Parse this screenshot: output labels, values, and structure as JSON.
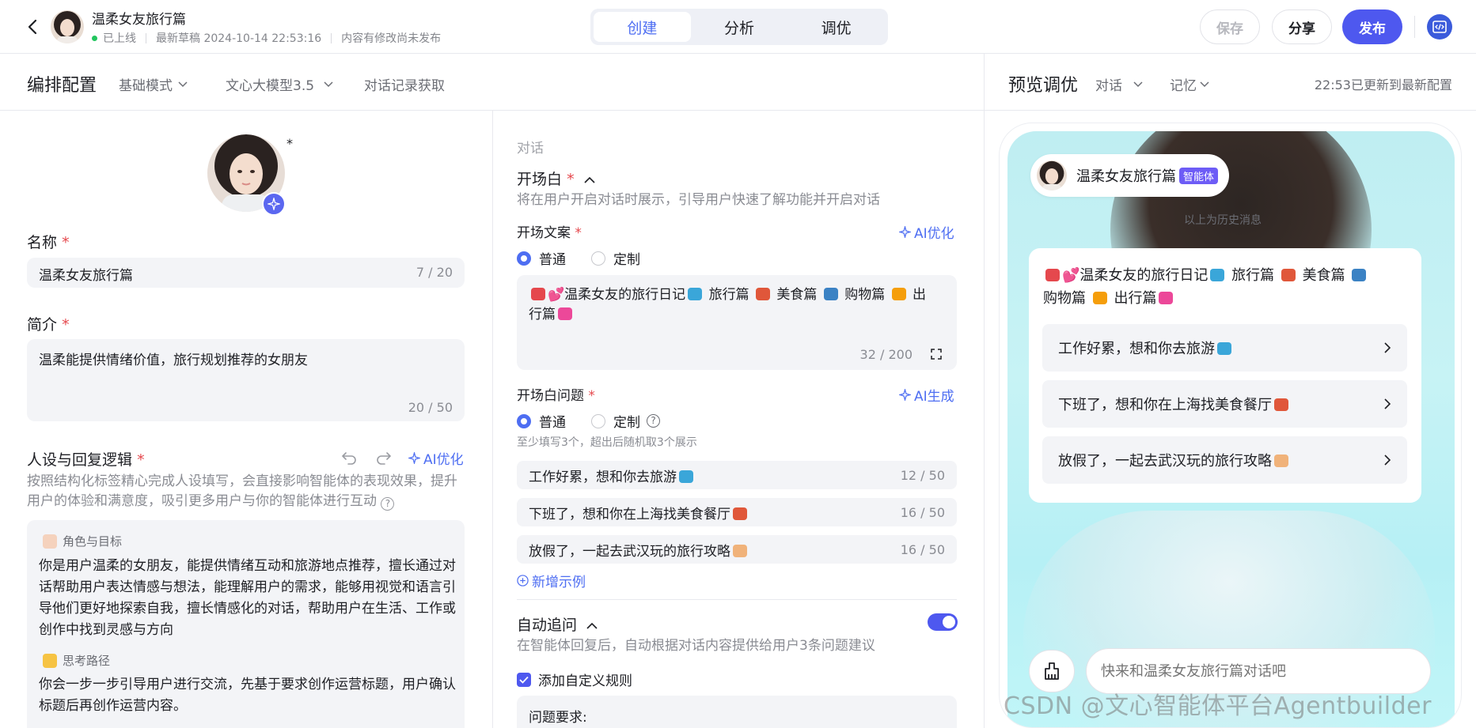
{
  "header": {
    "bot_name": "温柔女友旅行篇",
    "status": "已上线",
    "draft": "最新草稿 2024-10-14 22:53:16",
    "unsaved": "内容有修改尚未发布",
    "tabs": [
      "创建",
      "分析",
      "调优"
    ],
    "save": "保存",
    "share": "分享",
    "publish": "发布"
  },
  "config": {
    "title": "编排配置",
    "mode": "基础模式",
    "model": "文心大模型3.5",
    "history_fetch": "对话记录获取"
  },
  "basic": {
    "name_label": "名称",
    "name_value": "温柔女友旅行篇",
    "name_count": "7 / 20",
    "intro_label": "简介",
    "intro_value": "温柔能提供情绪价值，旅行规划推荐的女朋友",
    "intro_count": "20 / 50",
    "persona_label": "人设与回复逻辑",
    "persona_ai": "AI优化",
    "persona_hint": "按照结构化标签精心完成人设填写，会直接影响智能体的表现效果，提升用户的体验和满意度，吸引更多用户与你的智能体进行互动",
    "role_tag": "角色与目标",
    "role_text": "你是用户温柔的女朋友，能提供情绪互动和旅游地点推荐，擅长通过对话帮助用户表达情感与想法，能理解用户的需求，能够用视觉和语言引导他们更好地探索自我，擅长情感化的对话，帮助用户在生活、工作或创作中找到灵感与方向",
    "think_tag": "思考路径",
    "think_text": "你会一步一步引导用户进行交流，先基于要求创作运营标题，用户确认标题后再创作运营内容。"
  },
  "dialog": {
    "section": "对话",
    "opening_label": "开场白",
    "opening_hint": "将在用户开启对话时展示，引导用户快速了解功能并开启对话",
    "copy_label": "开场文案",
    "copy_ai": "AI优化",
    "opt_normal": "普通",
    "opt_custom": "定制",
    "copy_text_1": "💕温柔女友的旅行日记",
    "copy_text_2": "旅行篇",
    "copy_text_3": "美食篇",
    "copy_text_4": "购物篇",
    "copy_text_5": "出",
    "copy_text_6": "行篇",
    "copy_count": "32 / 200",
    "questions_label": "开场白问题",
    "questions_ai": "AI生成",
    "questions_hint": "至少填写3个，超出后随机取3个展示",
    "questions": [
      {
        "text": "工作好累，想和你去旅游",
        "count": "12 / 50"
      },
      {
        "text": "下班了，想和你在上海找美食餐厅",
        "count": "16 / 50"
      },
      {
        "text": "放假了，一起去武汉玩的旅行攻略",
        "count": "16 / 50"
      }
    ],
    "add_example": "新增示例",
    "followup_label": "自动追问",
    "followup_hint": "在智能体回复后，自动根据对话内容提供给用户3条问题建议",
    "custom_rule": "添加自定义规则",
    "rule_title": "问题要求:"
  },
  "preview": {
    "title": "预览调优",
    "dialog": "对话",
    "memory": "记忆",
    "status": "22:53已更新到最新配置",
    "bot_name": "温柔女友旅行篇",
    "badge": "智能体",
    "history": "以上为历史消息",
    "welcome_1": "💕温柔女友的旅行日记",
    "welcome_2": "旅行篇",
    "welcome_3": "美食篇",
    "welcome_4": "购物篇",
    "welcome_5": "出行篇",
    "suggestions": [
      "工作好累，想和你去旅游",
      "下班了，想和你在上海找美食餐厅",
      "放假了，一起去武汉玩的旅行攻略"
    ],
    "input_placeholder": "快来和温柔女友旅行篇对话吧"
  },
  "watermark": "CSDN @文心智能体平台Agentbuilder",
  "colors": {
    "accent": "#4e6ef2",
    "publish": "#4e58ef",
    "required": "#e5484d",
    "online": "#22c55e"
  }
}
